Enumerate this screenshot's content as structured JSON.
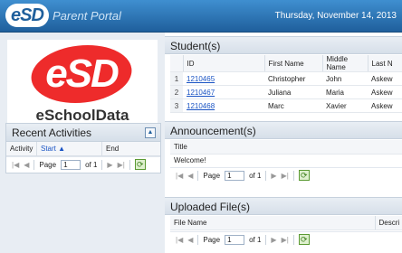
{
  "header": {
    "logo": "eSD",
    "title": "Parent Portal",
    "date": "Thursday, November 14, 2013"
  },
  "brand": {
    "logo_text": "eSD",
    "name": "eSchoolData"
  },
  "recent_activities": {
    "title": "Recent Activities",
    "columns": [
      "Activity",
      "Start",
      "End"
    ],
    "pager": {
      "page_label": "Page",
      "page_value": "1",
      "of_label": "of 1"
    }
  },
  "students": {
    "title": "Student(s)",
    "columns": [
      "ID",
      "First Name",
      "Middle Name",
      "Last N"
    ],
    "rows": [
      {
        "n": "1",
        "id": "1210465",
        "first": "Christopher",
        "middle": "John",
        "last": "Askew"
      },
      {
        "n": "2",
        "id": "1210467",
        "first": "Juliana",
        "middle": "Maria",
        "last": "Askew"
      },
      {
        "n": "3",
        "id": "1210468",
        "first": "Marc",
        "middle": "Xavier",
        "last": "Askew"
      }
    ]
  },
  "announcements": {
    "title": "Announcement(s)",
    "column": "Title",
    "rows": [
      "Welcome!"
    ],
    "pager": {
      "page_label": "Page",
      "page_value": "1",
      "of_label": "of 1"
    }
  },
  "uploaded_files": {
    "title": "Uploaded File(s)",
    "columns": [
      "File Name",
      "Descri"
    ],
    "pager": {
      "page_label": "Page",
      "page_value": "1",
      "of_label": "of 1"
    }
  }
}
